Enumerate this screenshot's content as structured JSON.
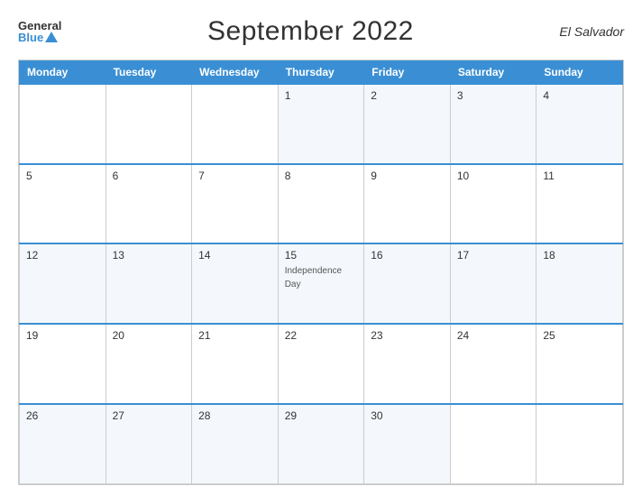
{
  "header": {
    "logo_general": "General",
    "logo_blue": "Blue",
    "title": "September 2022",
    "country": "El Salvador"
  },
  "calendar": {
    "days_of_week": [
      "Monday",
      "Tuesday",
      "Wednesday",
      "Thursday",
      "Friday",
      "Saturday",
      "Sunday"
    ],
    "weeks": [
      [
        {
          "day": "",
          "empty": true
        },
        {
          "day": "",
          "empty": true
        },
        {
          "day": "",
          "empty": true
        },
        {
          "day": "1",
          "events": []
        },
        {
          "day": "2",
          "events": []
        },
        {
          "day": "3",
          "events": []
        },
        {
          "day": "4",
          "events": []
        }
      ],
      [
        {
          "day": "5",
          "events": []
        },
        {
          "day": "6",
          "events": []
        },
        {
          "day": "7",
          "events": []
        },
        {
          "day": "8",
          "events": []
        },
        {
          "day": "9",
          "events": []
        },
        {
          "day": "10",
          "events": []
        },
        {
          "day": "11",
          "events": []
        }
      ],
      [
        {
          "day": "12",
          "events": []
        },
        {
          "day": "13",
          "events": []
        },
        {
          "day": "14",
          "events": []
        },
        {
          "day": "15",
          "events": [
            "Independence Day"
          ]
        },
        {
          "day": "16",
          "events": []
        },
        {
          "day": "17",
          "events": []
        },
        {
          "day": "18",
          "events": []
        }
      ],
      [
        {
          "day": "19",
          "events": []
        },
        {
          "day": "20",
          "events": []
        },
        {
          "day": "21",
          "events": []
        },
        {
          "day": "22",
          "events": []
        },
        {
          "day": "23",
          "events": []
        },
        {
          "day": "24",
          "events": []
        },
        {
          "day": "25",
          "events": []
        }
      ],
      [
        {
          "day": "26",
          "events": []
        },
        {
          "day": "27",
          "events": []
        },
        {
          "day": "28",
          "events": []
        },
        {
          "day": "29",
          "events": []
        },
        {
          "day": "30",
          "events": []
        },
        {
          "day": "",
          "empty": true
        },
        {
          "day": "",
          "empty": true
        }
      ]
    ]
  }
}
